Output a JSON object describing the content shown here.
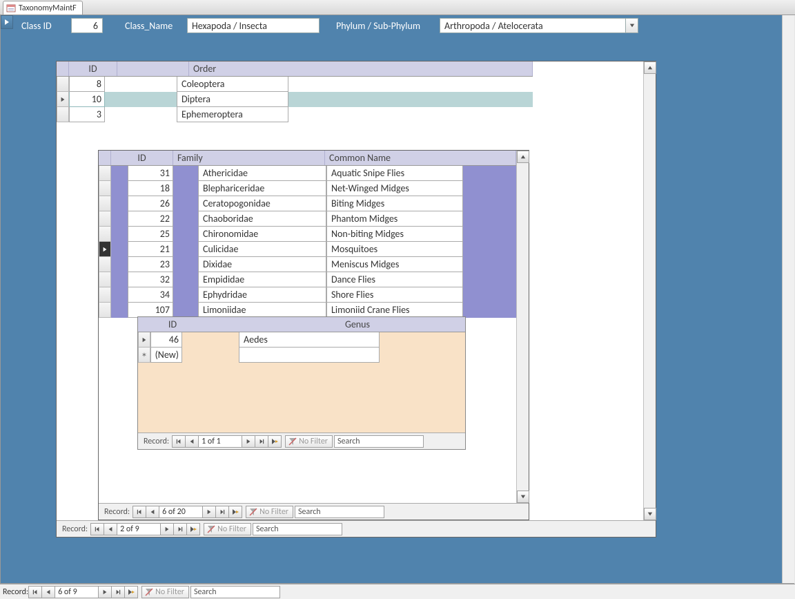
{
  "tab": {
    "title": "TaxonomyMaintF"
  },
  "class_header": {
    "class_id_label": "Class ID",
    "class_id_value": "6",
    "class_name_label": "Class_Name",
    "class_name_value": "Hexapoda / Insecta",
    "phylum_label": "Phylum / Sub-Phylum",
    "phylum_value": "Arthropoda / Atelocerata"
  },
  "orders": {
    "id_header": "ID",
    "order_header": "Order",
    "rows": [
      {
        "id": "8",
        "name": "Coleoptera",
        "selected": false
      },
      {
        "id": "10",
        "name": "Diptera",
        "selected": true
      },
      {
        "id": "3",
        "name": "Ephemeroptera",
        "selected": false
      }
    ],
    "nav": {
      "pos": "2 of 9",
      "filter_label": "No Filter",
      "search_label": "Search"
    }
  },
  "families": {
    "id_header": "ID",
    "family_header": "Family",
    "common_header": "Common Name",
    "rows": [
      {
        "id": "31",
        "family": "Athericidae",
        "common": "Aquatic Snipe Flies",
        "selected": false
      },
      {
        "id": "18",
        "family": "Blephariceridae",
        "common": "Net-Winged Midges",
        "selected": false
      },
      {
        "id": "26",
        "family": "Ceratopogonidae",
        "common": "Biting Midges",
        "selected": false
      },
      {
        "id": "22",
        "family": "Chaoboridae",
        "common": "Phantom Midges",
        "selected": false
      },
      {
        "id": "25",
        "family": "Chironomidae",
        "common": "Non-biting Midges",
        "selected": false
      },
      {
        "id": "21",
        "family": "Culicidae",
        "common": "Mosquitoes",
        "selected": true
      },
      {
        "id": "23",
        "family": "Dixidae",
        "common": "Meniscus Midges",
        "selected": false
      },
      {
        "id": "32",
        "family": "Empididae",
        "common": "Dance Flies",
        "selected": false
      },
      {
        "id": "34",
        "family": "Ephydridae",
        "common": "Shore Flies",
        "selected": false
      },
      {
        "id": "107",
        "family": "Limoniidae",
        "common": "Limoniid Crane Flies",
        "selected": false
      }
    ],
    "nav": {
      "pos": "6 of 20",
      "filter_label": "No Filter",
      "search_label": "Search"
    }
  },
  "genera": {
    "id_header": "ID",
    "genus_header": "Genus",
    "rows": [
      {
        "id": "46",
        "genus": "Aedes",
        "selected": true,
        "newrow": false
      },
      {
        "id": "(New)",
        "genus": "",
        "selected": false,
        "newrow": true
      }
    ],
    "nav": {
      "pos": "1 of 1",
      "filter_label": "No Filter",
      "search_label": "Search"
    }
  },
  "class_nav": {
    "pos": "6 of 9",
    "filter_label": "No Filter",
    "search_label": "Search"
  },
  "record_label": "Record:"
}
